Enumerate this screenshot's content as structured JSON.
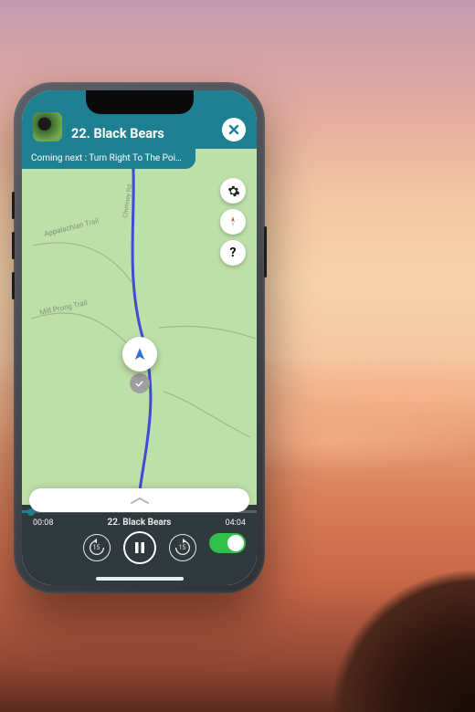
{
  "header": {
    "title": "22. Black Bears",
    "close_icon": "close-icon"
  },
  "upnext": {
    "label": "Coming next : Turn Right To The Poin..."
  },
  "map": {
    "road_label": "Chimney Rd",
    "trail_labels": [
      "Appalachian Trail",
      "Mill Prong Trail"
    ],
    "buttons": {
      "settings": "settings-icon",
      "compass": "compass-icon",
      "help": "?"
    },
    "location_icon": "navigation-arrow-icon",
    "checkpoint_icon": "check-icon"
  },
  "sheet": {
    "handle_icon": "chevron-up-icon"
  },
  "player": {
    "elapsed": "00:08",
    "track_title": "22. Black Bears",
    "total": "04:04",
    "rewind_label": "15",
    "forward_label": "15",
    "play_state": "paused",
    "toggle_on": true,
    "progress_percent": 4
  },
  "colors": {
    "brand_teal": "#1f8092",
    "player_bg": "#30393e",
    "map_green": "#bde0a8",
    "toggle_green": "#2fbf4a"
  }
}
